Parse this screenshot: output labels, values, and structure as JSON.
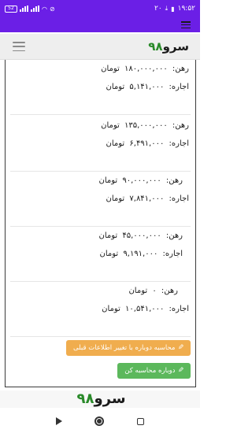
{
  "status_bar": {
    "time": "۱۹:۵۲",
    "extra": "۲۰",
    "battery": "52"
  },
  "header": {
    "brand_name": "سرو",
    "brand_number": "۹۸"
  },
  "results": [
    {
      "rent_label": "رهن:",
      "rent_value": "۱۸۰,۰۰۰,۰۰۰",
      "rent_unit": "تومان",
      "lease_label": "اجاره:",
      "lease_value": "۵,۱۴۱,۰۰۰",
      "lease_unit": "تومان"
    },
    {
      "rent_label": "رهن:",
      "rent_value": "۱۳۵,۰۰۰,۰۰۰",
      "rent_unit": "تومان",
      "lease_label": "اجاره:",
      "lease_value": "۶,۴۹۱,۰۰۰",
      "lease_unit": "تومان"
    },
    {
      "rent_label": "رهن:",
      "rent_value": "۹۰,۰۰۰,۰۰۰",
      "rent_unit": "تومان",
      "lease_label": "اجاره:",
      "lease_value": "۷,۸۴۱,۰۰۰",
      "lease_unit": "تومان"
    },
    {
      "rent_label": "رهن:",
      "rent_value": "۴۵,۰۰۰,۰۰۰",
      "rent_unit": "تومان",
      "lease_label": "اجاره:",
      "lease_value": "۹,۱۹۱,۰۰۰",
      "lease_unit": "تومان"
    },
    {
      "rent_label": "رهن:",
      "rent_value": "۰",
      "rent_unit": "تومان",
      "lease_label": "اجاره:",
      "lease_value": "۱۰,۵۴۱,۰۰۰",
      "lease_unit": "تومان"
    }
  ],
  "actions": {
    "recalc_edit_label": "محاسبه دوباره با تغییر اطلاعات قبلی",
    "recalc_label": "دوباره محاسبه کن"
  },
  "footer": {
    "brand_name": "سرو",
    "brand_number": "۹۸"
  },
  "colors": {
    "primary": "#6b1fe6",
    "warning": "#f0ad4e",
    "success": "#5cb85c",
    "brand_green": "#2a8a2a"
  }
}
